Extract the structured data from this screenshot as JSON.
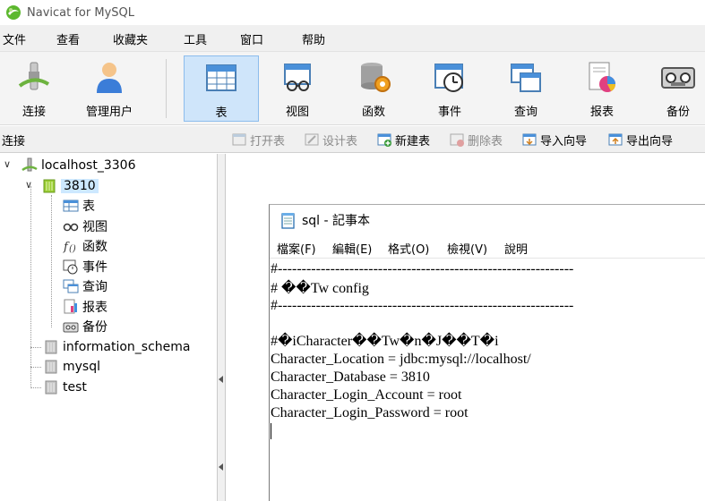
{
  "app": {
    "title": "Navicat for MySQL"
  },
  "menu": [
    "文件",
    "查看",
    "收藏夹",
    "工具",
    "窗口",
    "帮助"
  ],
  "toolbar": {
    "connect": "连接",
    "user_manage": "管理用户",
    "table": "表",
    "view": "视图",
    "function": "函数",
    "event": "事件",
    "query": "查询",
    "report": "报表",
    "backup": "备份"
  },
  "subbar": {
    "connection_label": "连接",
    "open_table": "打开表",
    "design_table": "设计表",
    "new_table": "新建表",
    "delete_table": "删除表",
    "import_wizard": "导入向导",
    "export_wizard": "导出向导"
  },
  "tree": {
    "connection": "localhost_3306",
    "database": "3810",
    "children": [
      "表",
      "视图",
      "函数",
      "事件",
      "查询",
      "报表",
      "备份"
    ],
    "other_dbs": [
      "information_schema",
      "mysql",
      "test"
    ]
  },
  "notepad": {
    "title": "sql - 記事本",
    "menu": [
      "檔案(F)",
      "編輯(E)",
      "格式(O)",
      "檢視(V)",
      "說明"
    ],
    "lines": [
      "#--------------------------------------------------------------",
      "# ��Tw config",
      "#--------------------------------------------------------------",
      "",
      "#�iCharacter��Tw�n�J��T�i",
      "Character_Location = jdbc:mysql://localhost/",
      "Character_Database = 3810",
      "Character_Login_Account = root",
      "Character_Login_Password = root"
    ]
  },
  "colors": {
    "toolbar_active_bg": "#cfe5fa",
    "tree_selected_bg": "#cde8ff",
    "db_icon_active": "#9acd32"
  }
}
